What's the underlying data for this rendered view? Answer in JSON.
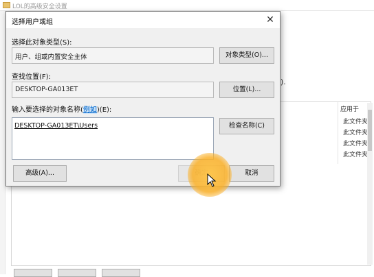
{
  "background_window": {
    "title": "LOL的高级安全设置",
    "right_fragment": ").",
    "left_fragment": "...",
    "column_header": "应用于",
    "rows": [
      "此文件夹,",
      "此文件夹,",
      "此文件夹,",
      "此文件夹,"
    ]
  },
  "dialog": {
    "title": "选择用户或组",
    "close_glyph": "✕",
    "object_type_label": "选择此对象类型(S):",
    "object_type_value": "用户、组或内置安全主体",
    "object_type_button": "对象类型(O)...",
    "location_label": "查找位置(F):",
    "location_value": "DESKTOP-GA013ET",
    "location_button": "位置(L)...",
    "names_label_prefix": "输入要选择的对象名称(",
    "names_label_link": "例如",
    "names_label_suffix": ")(E):",
    "names_value": "DESKTOP-GA013ET\\Users",
    "check_names_button": "检查名称(C)",
    "advanced_button": "高级(A)...",
    "ok_button": "确定",
    "cancel_button": "取消"
  }
}
